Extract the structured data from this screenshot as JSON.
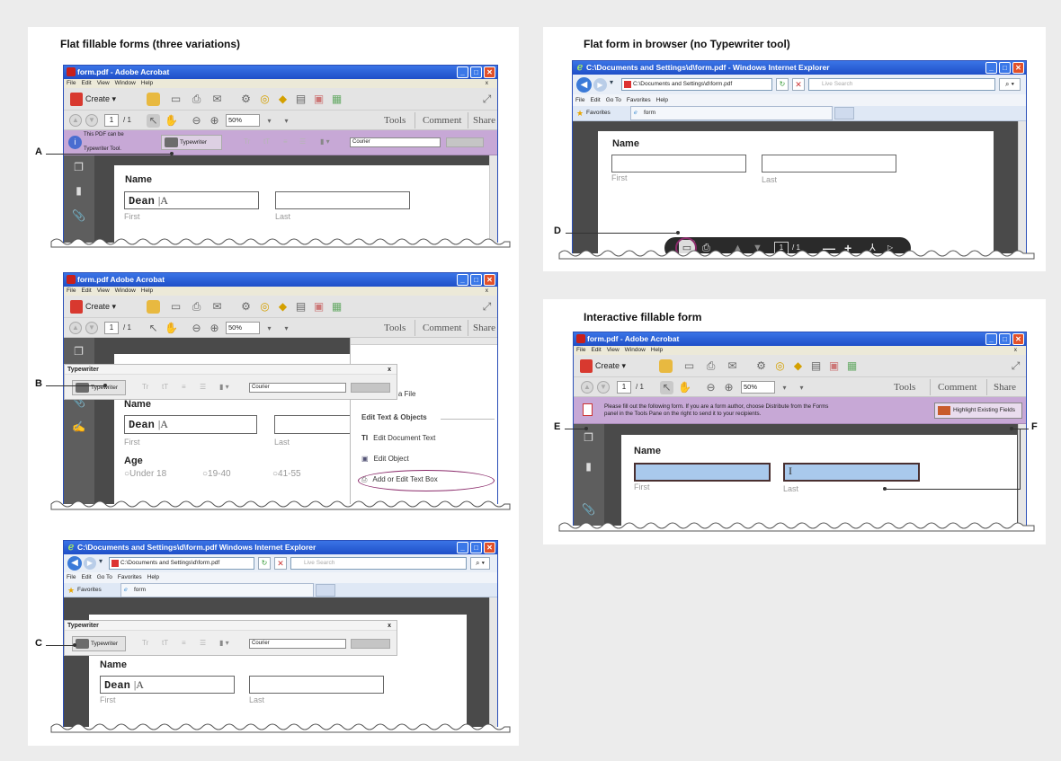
{
  "panels": {
    "flat": {
      "title": "Flat fillable forms (three variations)"
    },
    "browser": {
      "title": "Flat form in browser (no Typewriter tool)"
    },
    "interactive": {
      "title": "Interactive fillable form"
    }
  },
  "acrobat": {
    "title": "form.pdf - Adobe Acrobat",
    "title_b": "form.pdf  Adobe Acrobat",
    "menu": [
      "File",
      "Edit",
      "View",
      "Window",
      "Help"
    ],
    "menu_close": "x",
    "create": "Create ▾",
    "page_current": "1",
    "page_total": "/ 1",
    "zoom": "50%",
    "tabs": {
      "tools": "Tools",
      "comment": "Comment",
      "share": "Share"
    }
  },
  "ie": {
    "title": "C:\\Documents and Settings\\d\\form.pdf - Windows Internet Explorer",
    "title_c": "C:\\Documents and Settings\\d\\form.pdf  Windows Internet Explorer",
    "address": "C:\\Documents and Settings\\d\\form.pdf",
    "live_search": "Live Search",
    "menu": [
      "File",
      "Edit",
      "Go To",
      "Favorites",
      "Help"
    ],
    "favorites": "Favorites",
    "tab": "form"
  },
  "typewriter": {
    "notice": "This PDF can be ... Typewriter Tool.",
    "notice_l1": "This PDF can be",
    "notice_l3": "Typewriter Tool.",
    "panel_title": "Typewriter",
    "button": "Typewriter",
    "font": "Courier",
    "close": "x"
  },
  "form": {
    "name_label": "Name",
    "first": "First",
    "last": "Last",
    "typed": "Dean",
    "cursor_text": "|A",
    "age_label": "Age",
    "age_options": [
      "Under 18",
      "19-40",
      "41-55"
    ]
  },
  "toolpane": {
    "attach": "Attach a File",
    "section": "Edit Text & Objects",
    "edit_text": "Edit Document Text",
    "edit_object": "Edit Object",
    "add_textbox": "Add or Edit Text Box"
  },
  "floatbar": {
    "page_current": "1",
    "page_total": "/ 1"
  },
  "interactive_form": {
    "message": "Please fill out the following form. If you are a form author, choose Distribute from the Forms panel in the Tools Pane on the right to send it to your recipients.",
    "message_l1": "Please fill out the following form. If you are a form author, choose Distribute from the Forms",
    "message_l2": "panel in the Tools Pane on the right to send it to your recipients.",
    "highlight_button": "Highlight Existing Fields"
  },
  "callouts": {
    "a": "A",
    "b": "B",
    "c": "C",
    "d": "D",
    "e": "E",
    "f": "F"
  },
  "colors": {
    "title_bar": "#2457d6",
    "purple_bar": "#c7a8d6",
    "highlight_field": "#a9c9ec",
    "callout_ellipse": "#8a2a6a"
  }
}
